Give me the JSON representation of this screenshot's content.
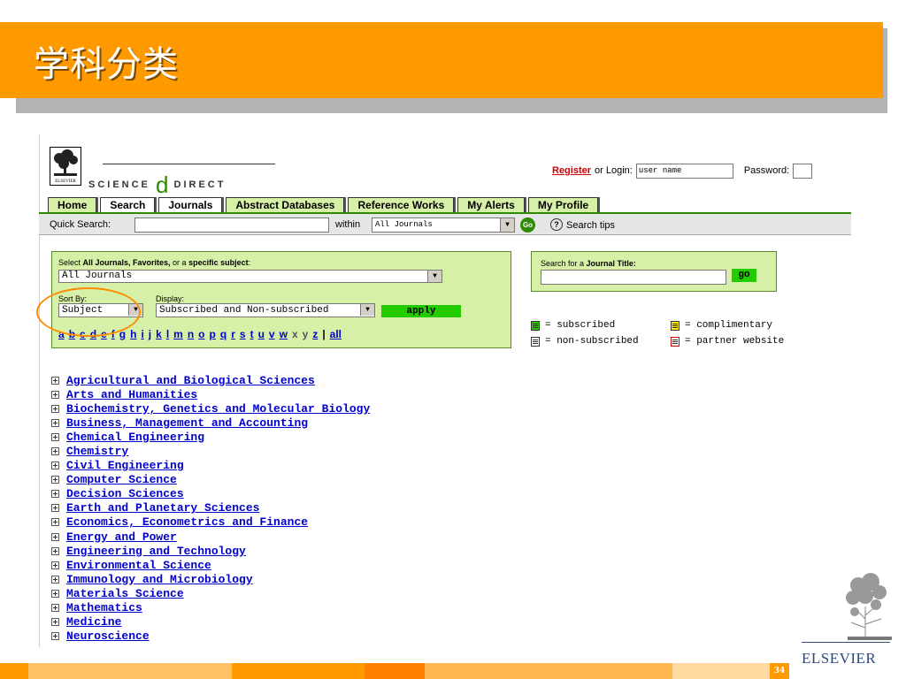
{
  "slide": {
    "title": "学科分类",
    "page_number": "34",
    "publisher_logo_text": "ELSEVIER"
  },
  "site": {
    "logo_small_text": "ELSEVIER",
    "wordmark_left": "SCIENCE",
    "wordmark_at": "d",
    "wordmark_right": "DIRECT"
  },
  "login": {
    "register_label": "Register",
    "or_login_label": "or Login:",
    "username_value": "user name",
    "password_label": "Password:"
  },
  "nav": {
    "tabs": [
      "Home",
      "Search",
      "Journals",
      "Abstract Databases",
      "Reference Works",
      "My Alerts",
      "My Profile"
    ]
  },
  "quick_search": {
    "label": "Quick Search:",
    "within_label": "within",
    "within_value": "All Journals",
    "go_label": "Go",
    "tips_label": "Search tips"
  },
  "select_panel": {
    "label_prefix": "Select ",
    "label_b1": "All Journals, Favorites,",
    "label_mid": " or a ",
    "label_b2": "specific subject",
    "label_suffix": ":",
    "select_value": "All Journals",
    "sort_label": "Sort By:",
    "sort_value": "Subject",
    "display_label": "Display:",
    "display_value": "Subscribed and Non-subscribed",
    "apply_label": "apply",
    "letters_linked": [
      "a",
      "b",
      "c",
      "d",
      "e",
      "f",
      "g",
      "h",
      "i",
      "j",
      "k",
      "l",
      "m",
      "n",
      "o",
      "p",
      "q",
      "r",
      "s",
      "t",
      "u",
      "v",
      "w"
    ],
    "letters_plain": [
      "x",
      "y"
    ],
    "letter_z": "z",
    "separator": "|",
    "all_label": "all"
  },
  "journal_panel": {
    "label_prefix": "Search for a ",
    "label_bold": "Journal Title:",
    "go_label": "go"
  },
  "legend": {
    "subscribed": "= subscribed",
    "complimentary": "= complimentary",
    "non_subscribed": "= non-subscribed",
    "partner": "= partner website"
  },
  "subjects": [
    "Agricultural and Biological Sciences",
    "Arts and Humanities",
    "Biochemistry, Genetics and Molecular Biology",
    "Business, Management and Accounting",
    "Chemical Engineering",
    "Chemistry",
    "Civil Engineering",
    "Computer Science",
    "Decision Sciences",
    "Earth and Planetary Sciences",
    "Economics, Econometrics and Finance",
    "Energy and Power",
    "Engineering and Technology",
    "Environmental Science",
    "Immunology and Microbiology",
    "Materials Science",
    "Mathematics",
    "Medicine",
    "Neuroscience"
  ],
  "colors": {
    "slide_orange": "#FF9900",
    "panel_green": "#D7F0A8",
    "button_green": "#22CC00",
    "link_blue": "#0000CC",
    "register_red": "#CC0000",
    "highlight_ring": "#FF8C00"
  }
}
